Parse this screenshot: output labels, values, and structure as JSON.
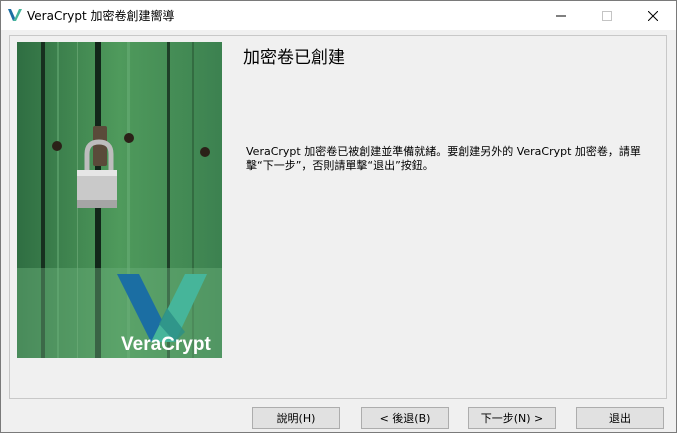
{
  "window": {
    "title": "VeraCrypt 加密卷創建嚮導"
  },
  "page": {
    "heading": "加密卷已創建",
    "message": "VeraCrypt 加密卷已被創建並準備就緒。要創建另外的 VeraCrypt 加密卷，請單擊“下一步”，否則請單擊“退出”按鈕。"
  },
  "banner": {
    "logo_text": "VeraCrypt"
  },
  "buttons": {
    "help": "說明(H)",
    "back": "< 後退(B)",
    "next": "下一步(N) >",
    "exit": "退出"
  },
  "colors": {
    "wood_green": "#3f8a52",
    "logo_blue": "#1b6ea3",
    "logo_teal": "#46b59a"
  },
  "icons": {
    "app": "veracrypt-logo-icon",
    "minimize": "minimize-icon",
    "maximize": "maximize-icon",
    "close": "close-icon"
  }
}
